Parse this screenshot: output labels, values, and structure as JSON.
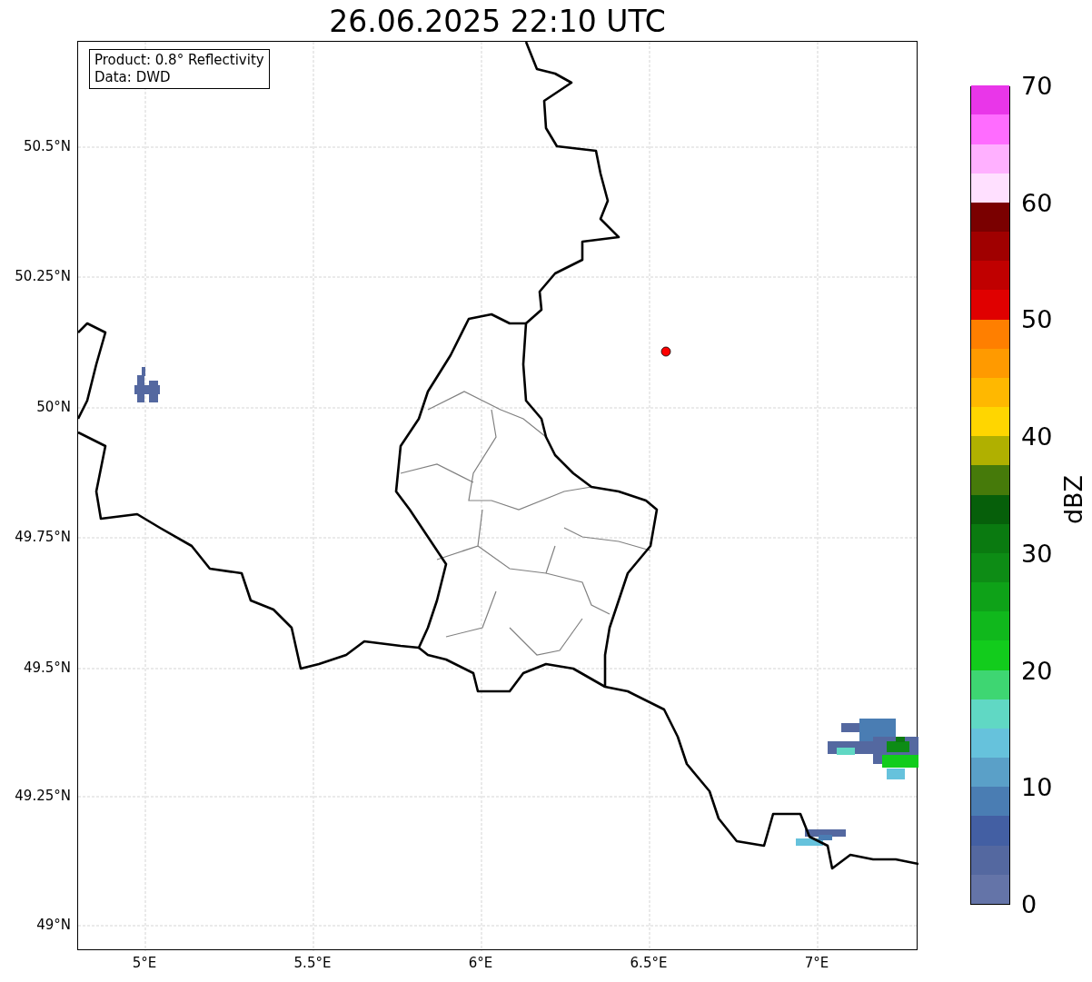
{
  "title": "26.06.2025 22:10 UTC",
  "info_box": [
    "Product: 0.8° Reflectivity",
    "Data: DWD"
  ],
  "map": {
    "x_ticks": [
      "5°E",
      "5.5°E",
      "6°E",
      "6.5°E",
      "7°E"
    ],
    "y_ticks": [
      "50.5°N",
      "50.25°N",
      "50°N",
      "49.75°N",
      "49.5°N",
      "49.25°N",
      "49°N"
    ]
  },
  "colorbar": {
    "label": "dBZ",
    "ticks": [
      "70",
      "60",
      "50",
      "40",
      "30",
      "20",
      "10",
      "0"
    ],
    "bins": [
      {
        "color": "#6474a8"
      },
      {
        "color": "#5468a0"
      },
      {
        "color": "#435fa3"
      },
      {
        "color": "#4a7db3"
      },
      {
        "color": "#5aa0c8"
      },
      {
        "color": "#66c2dc"
      },
      {
        "color": "#60d8c4"
      },
      {
        "color": "#3ed672"
      },
      {
        "color": "#12cc1c"
      },
      {
        "color": "#10b81c"
      },
      {
        "color": "#0ea218"
      },
      {
        "color": "#0d8c15"
      },
      {
        "color": "#0a7a10"
      },
      {
        "color": "#065f0a"
      },
      {
        "color": "#467a0a"
      },
      {
        "color": "#b0b000"
      },
      {
        "color": "#ffd600"
      },
      {
        "color": "#ffb800"
      },
      {
        "color": "#ff9a00"
      },
      {
        "color": "#ff7f00"
      },
      {
        "color": "#e00000"
      },
      {
        "color": "#c00000"
      },
      {
        "color": "#a00000"
      },
      {
        "color": "#7a0000"
      },
      {
        "color": "#ffe0ff"
      },
      {
        "color": "#ffb0ff"
      },
      {
        "color": "#ff6cff"
      },
      {
        "color": "#e936e9"
      }
    ]
  }
}
